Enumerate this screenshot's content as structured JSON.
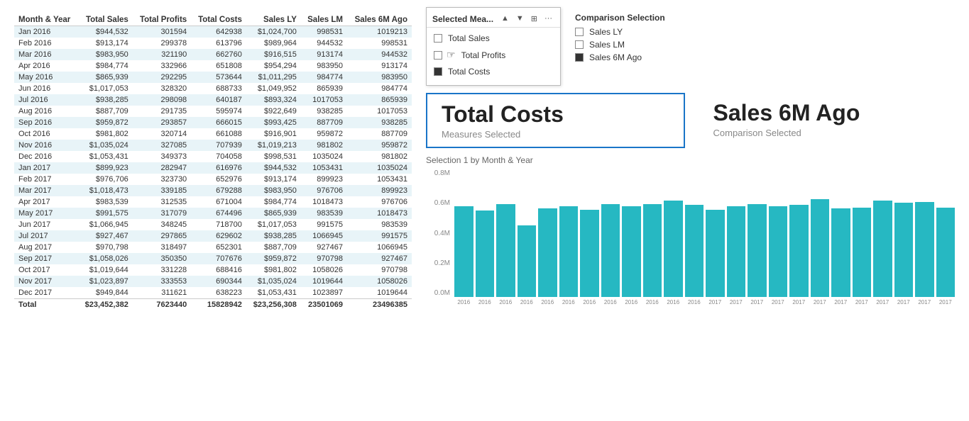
{
  "table": {
    "headers": [
      "Month & Year",
      "Total Sales",
      "Total Profits",
      "Total Costs",
      "Sales LY",
      "Sales LM",
      "Sales 6M Ago"
    ],
    "rows": [
      [
        "Jan 2016",
        "$944,532",
        "301594",
        "642938",
        "$1,024,700",
        "998531",
        "1019213"
      ],
      [
        "Feb 2016",
        "$913,174",
        "299378",
        "613796",
        "$989,964",
        "944532",
        "998531"
      ],
      [
        "Mar 2016",
        "$983,950",
        "321190",
        "662760",
        "$916,515",
        "913174",
        "944532"
      ],
      [
        "Apr 2016",
        "$984,774",
        "332966",
        "651808",
        "$954,294",
        "983950",
        "913174"
      ],
      [
        "May 2016",
        "$865,939",
        "292295",
        "573644",
        "$1,011,295",
        "984774",
        "983950"
      ],
      [
        "Jun 2016",
        "$1,017,053",
        "328320",
        "688733",
        "$1,049,952",
        "865939",
        "984774"
      ],
      [
        "Jul 2016",
        "$938,285",
        "298098",
        "640187",
        "$893,324",
        "1017053",
        "865939"
      ],
      [
        "Aug 2016",
        "$887,709",
        "291735",
        "595974",
        "$922,649",
        "938285",
        "1017053"
      ],
      [
        "Sep 2016",
        "$959,872",
        "293857",
        "666015",
        "$993,425",
        "887709",
        "938285"
      ],
      [
        "Oct 2016",
        "$981,802",
        "320714",
        "661088",
        "$916,901",
        "959872",
        "887709"
      ],
      [
        "Nov 2016",
        "$1,035,024",
        "327085",
        "707939",
        "$1,019,213",
        "981802",
        "959872"
      ],
      [
        "Dec 2016",
        "$1,053,431",
        "349373",
        "704058",
        "$998,531",
        "1035024",
        "981802"
      ],
      [
        "Jan 2017",
        "$899,923",
        "282947",
        "616976",
        "$944,532",
        "1053431",
        "1035024"
      ],
      [
        "Feb 2017",
        "$976,706",
        "323730",
        "652976",
        "$913,174",
        "899923",
        "1053431"
      ],
      [
        "Mar 2017",
        "$1,018,473",
        "339185",
        "679288",
        "$983,950",
        "976706",
        "899923"
      ],
      [
        "Apr 2017",
        "$983,539",
        "312535",
        "671004",
        "$984,774",
        "1018473",
        "976706"
      ],
      [
        "May 2017",
        "$991,575",
        "317079",
        "674496",
        "$865,939",
        "983539",
        "1018473"
      ],
      [
        "Jun 2017",
        "$1,066,945",
        "348245",
        "718700",
        "$1,017,053",
        "991575",
        "983539"
      ],
      [
        "Jul 2017",
        "$927,467",
        "297865",
        "629602",
        "$938,285",
        "1066945",
        "991575"
      ],
      [
        "Aug 2017",
        "$970,798",
        "318497",
        "652301",
        "$887,709",
        "927467",
        "1066945"
      ],
      [
        "Sep 2017",
        "$1,058,026",
        "350350",
        "707676",
        "$959,872",
        "970798",
        "927467"
      ],
      [
        "Oct 2017",
        "$1,019,644",
        "331228",
        "688416",
        "$981,802",
        "1058026",
        "970798"
      ],
      [
        "Nov 2017",
        "$1,023,897",
        "333553",
        "690344",
        "$1,035,024",
        "1019644",
        "1058026"
      ],
      [
        "Dec 2017",
        "$949,844",
        "311621",
        "638223",
        "$1,053,431",
        "1023897",
        "1019644"
      ]
    ],
    "total_row": [
      "Total",
      "$23,452,382",
      "7623440",
      "15828942",
      "$23,256,308",
      "23501069",
      "23496385"
    ]
  },
  "dropdown": {
    "title": "Selected Mea...",
    "items": [
      {
        "label": "Total Sales",
        "checked": false
      },
      {
        "label": "Total Profits",
        "checked": false
      },
      {
        "label": "Total Costs",
        "checked": true
      }
    ],
    "up_arrow": "▲",
    "down_arrow": "▼",
    "dots": "•••",
    "grid_icon": "⊞"
  },
  "comparison": {
    "title": "Comparison Selection",
    "items": [
      {
        "label": "Sales LY",
        "checked": false
      },
      {
        "label": "Sales LM",
        "checked": false
      },
      {
        "label": "Sales 6M Ago",
        "checked": true
      }
    ]
  },
  "kpi_selected": {
    "title": "Total Costs",
    "subtitle": "Measures Selected"
  },
  "kpi_comparison": {
    "title": "Sales 6M Ago",
    "subtitle": "Comparison Selected"
  },
  "chart": {
    "title": "Selection 1 by Month & Year",
    "y_labels": [
      "0.8M",
      "0.6M",
      "0.4M",
      "0.2M",
      "0.0M"
    ],
    "bars": [
      {
        "label": "2016",
        "height": 80
      },
      {
        "label": "2016",
        "height": 76
      },
      {
        "label": "2016",
        "height": 82
      },
      {
        "label": "2016",
        "height": 63
      },
      {
        "label": "2016",
        "height": 78
      },
      {
        "label": "2016",
        "height": 80
      },
      {
        "label": "2016",
        "height": 77
      },
      {
        "label": "2016",
        "height": 82
      },
      {
        "label": "2016",
        "height": 80
      },
      {
        "label": "2016",
        "height": 82
      },
      {
        "label": "2016",
        "height": 85
      },
      {
        "label": "2016",
        "height": 81
      },
      {
        "label": "2017",
        "height": 77
      },
      {
        "label": "2017",
        "height": 80
      },
      {
        "label": "2017",
        "height": 82
      },
      {
        "label": "2017",
        "height": 80
      },
      {
        "label": "2017",
        "height": 81
      },
      {
        "label": "2017",
        "height": 86
      },
      {
        "label": "2017",
        "height": 78
      },
      {
        "label": "2017",
        "height": 79
      },
      {
        "label": "2017",
        "height": 85
      },
      {
        "label": "2017",
        "height": 83
      },
      {
        "label": "2017",
        "height": 84
      },
      {
        "label": "2017",
        "height": 79
      }
    ]
  }
}
